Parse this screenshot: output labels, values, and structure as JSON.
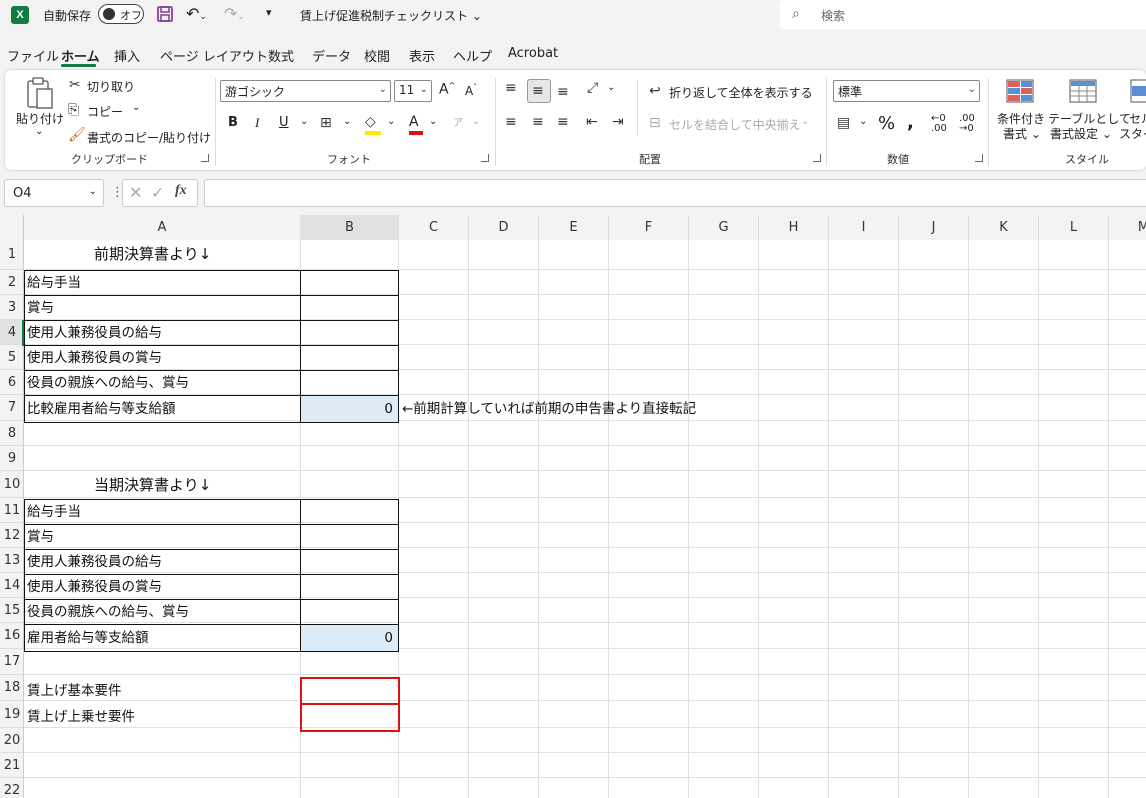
{
  "titlebar": {
    "app_logo": "X",
    "autosave_label": "自動保存",
    "autosave_state": "オフ",
    "document_title": "賃上げ促進税制チェックリスト",
    "search_placeholder": "検索"
  },
  "menu": {
    "tabs": [
      "ファイル",
      "ホーム",
      "挿入",
      "ページ レイアウト",
      "数式",
      "データ",
      "校閲",
      "表示",
      "ヘルプ",
      "Acrobat"
    ],
    "active": "ホーム"
  },
  "ribbon": {
    "clipboard": {
      "paste": "貼り付け",
      "cut": "切り取り",
      "copy": "コピー",
      "format_painter": "書式のコピー/貼り付け",
      "label": "クリップボード"
    },
    "font": {
      "name": "游ゴシック",
      "size": "11",
      "bold": "B",
      "italic": "I",
      "underline": "U",
      "label": "フォント"
    },
    "alignment": {
      "wrap": "折り返して全体を表示する",
      "merge": "セルを結合して中央揃え",
      "label": "配置"
    },
    "number": {
      "format": "標準",
      "label": "数値"
    },
    "styles": {
      "conditional": "条件付き",
      "conditional2": "書式",
      "table": "テーブルとして",
      "table2": "書式設定",
      "cell": "セル",
      "cell2": "スタイ",
      "label": "スタイル"
    }
  },
  "formula_bar": {
    "name_box": "O4",
    "fx": "fx",
    "content": ""
  },
  "sheet": {
    "columns": [
      "A",
      "B",
      "C",
      "D",
      "E",
      "F",
      "G",
      "H",
      "I",
      "J",
      "K",
      "L",
      "M"
    ],
    "rows": [
      "1",
      "2",
      "3",
      "4",
      "5",
      "6",
      "7",
      "8",
      "9",
      "10",
      "11",
      "12",
      "13",
      "14",
      "15",
      "16",
      "17",
      "18",
      "19",
      "20",
      "21",
      "22"
    ],
    "cells": {
      "A1": "前期決算書より↓",
      "A2": "給与手当",
      "A3": "賞与",
      "A4": "使用人兼務役員の給与",
      "A5": "使用人兼務役員の賞与",
      "A6": "役員の親族への給与、賞与",
      "A7": "比較雇用者給与等支給額",
      "B7": "0",
      "C7": "←前期計算していれば前期の申告書より直接転記",
      "A10": "当期決算書より↓",
      "A11": "給与手当",
      "A12": "賞与",
      "A13": "使用人兼務役員の給与",
      "A14": "使用人兼務役員の賞与",
      "A15": "役員の親族への給与、賞与",
      "A16": "雇用者給与等支給額",
      "B16": "0",
      "A18": "賃上げ基本要件",
      "A19": "賃上げ上乗せ要件"
    }
  },
  "colors": {
    "excel_green": "#107c41",
    "input_shade": "#ddebf7",
    "highlight_red": "#e01010"
  }
}
